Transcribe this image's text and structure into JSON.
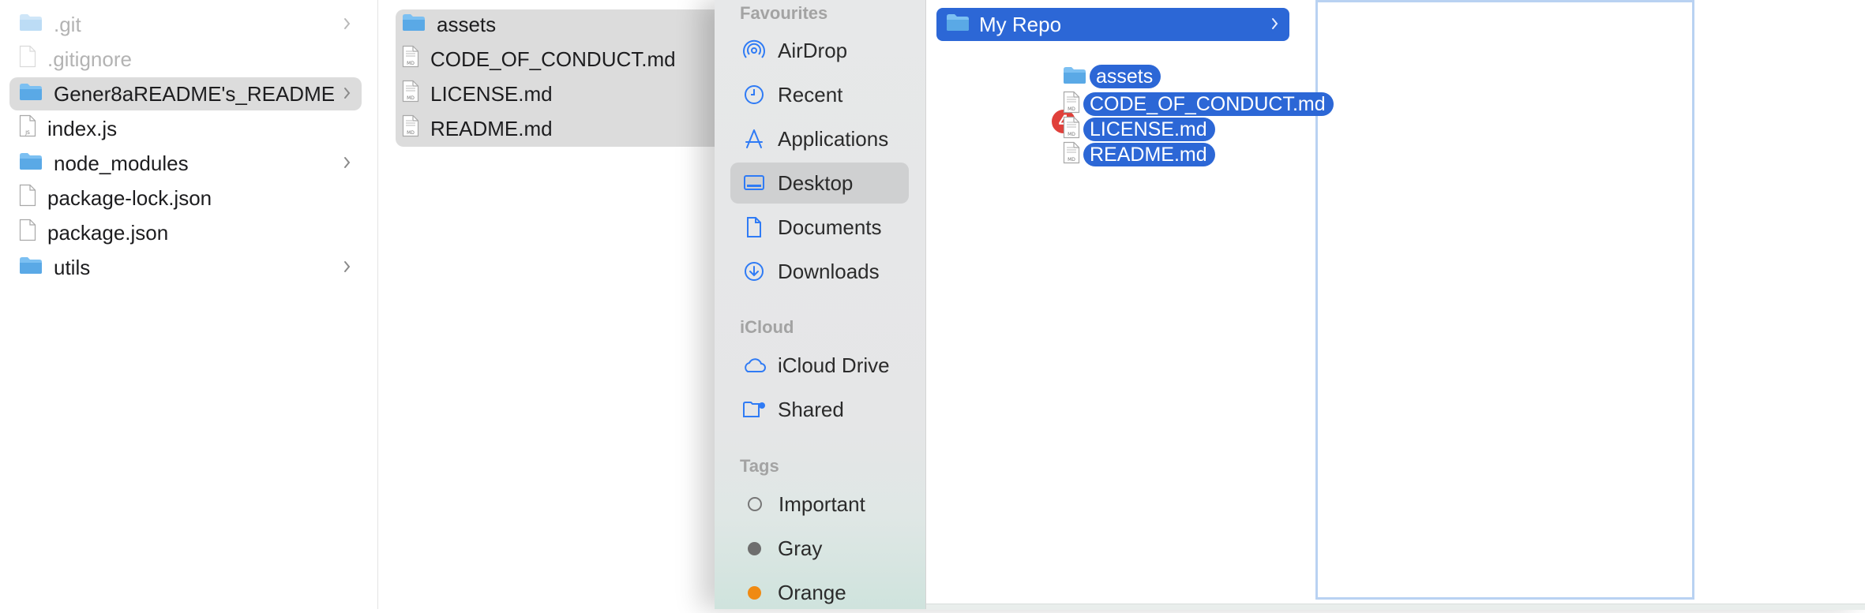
{
  "left_window": {
    "column1": [
      {
        "name": ".git",
        "kind": "folder",
        "dim": true,
        "chevron": true
      },
      {
        "name": ".gitignore",
        "kind": "doc",
        "dim": true,
        "chevron": false
      },
      {
        "name": "Gener8aREADME's_README",
        "kind": "folder",
        "dim": false,
        "chevron": true,
        "selected": true
      },
      {
        "name": "index.js",
        "kind": "doc-js",
        "dim": false,
        "chevron": false
      },
      {
        "name": "node_modules",
        "kind": "folder",
        "dim": false,
        "chevron": true
      },
      {
        "name": "package-lock.json",
        "kind": "doc",
        "dim": false,
        "chevron": false
      },
      {
        "name": "package.json",
        "kind": "doc",
        "dim": false,
        "chevron": false
      },
      {
        "name": "utils",
        "kind": "folder",
        "dim": false,
        "chevron": true
      }
    ],
    "column2": [
      {
        "name": "assets",
        "kind": "folder"
      },
      {
        "name": "CODE_OF_CONDUCT.md",
        "kind": "doc-md"
      },
      {
        "name": "LICENSE.md",
        "kind": "doc-md"
      },
      {
        "name": "README.md",
        "kind": "doc-md"
      }
    ]
  },
  "sidebar": {
    "favourites_label": "Favourites",
    "favourites": [
      {
        "label": "AirDrop",
        "icon": "airdrop-icon"
      },
      {
        "label": "Recent",
        "icon": "clock-icon"
      },
      {
        "label": "Applications",
        "icon": "applications-icon"
      },
      {
        "label": "Desktop",
        "icon": "desktop-icon",
        "active": true
      },
      {
        "label": "Documents",
        "icon": "document-icon"
      },
      {
        "label": "Downloads",
        "icon": "download-icon"
      }
    ],
    "icloud_label": "iCloud",
    "icloud": [
      {
        "label": "iCloud Drive",
        "icon": "cloud-icon"
      },
      {
        "label": "Shared",
        "icon": "shared-folder-icon"
      }
    ],
    "tags_label": "Tags",
    "tags": [
      {
        "label": "Important",
        "color": "hollow"
      },
      {
        "label": "Gray",
        "color": "#6e6e6e"
      },
      {
        "label": "Orange",
        "color": "#f08a12"
      }
    ]
  },
  "content": {
    "selected_folder": "My Repo"
  },
  "drag": {
    "count": "4",
    "items": [
      "assets",
      "CODE_OF_CONDUCT.md",
      "LICENSE.md",
      "README.md"
    ]
  },
  "colors": {
    "accent": "#2c67d6",
    "badge": "#e0403a",
    "folder": "#5fb0ee",
    "sidebar_icon": "#2f7bf5"
  }
}
